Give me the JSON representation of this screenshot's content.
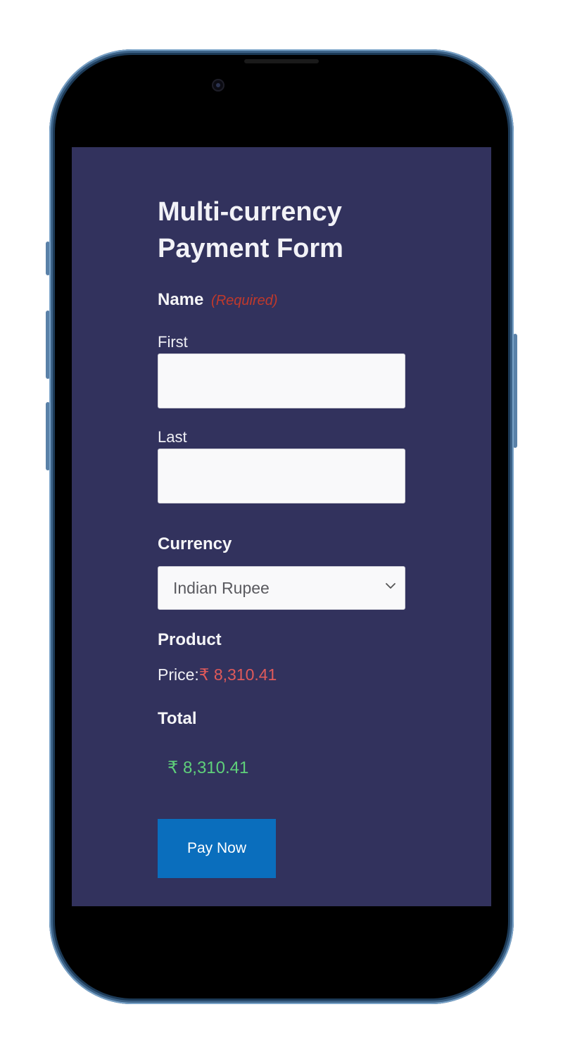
{
  "form": {
    "title": "Multi-currency Payment Form",
    "name_label": "Name",
    "required_text": "(Required)",
    "first_label": "First",
    "first_value": "",
    "last_label": "Last",
    "last_value": "",
    "currency_label": "Currency",
    "currency_selected": "Indian Rupee",
    "product_label": "Product",
    "price_prefix": "Price:",
    "price_value": "₹ 8,310.41",
    "total_label": "Total",
    "total_value": "₹ 8,310.41",
    "pay_button_label": "Pay Now"
  },
  "colors": {
    "screen_background": "#32325d",
    "required": "#c0392b",
    "price": "#e05a5a",
    "total": "#5fd07a",
    "button": "#0a6ebd"
  },
  "icons": {
    "select_arrow": "chevron-down-icon",
    "front_camera": "camera-icon"
  }
}
